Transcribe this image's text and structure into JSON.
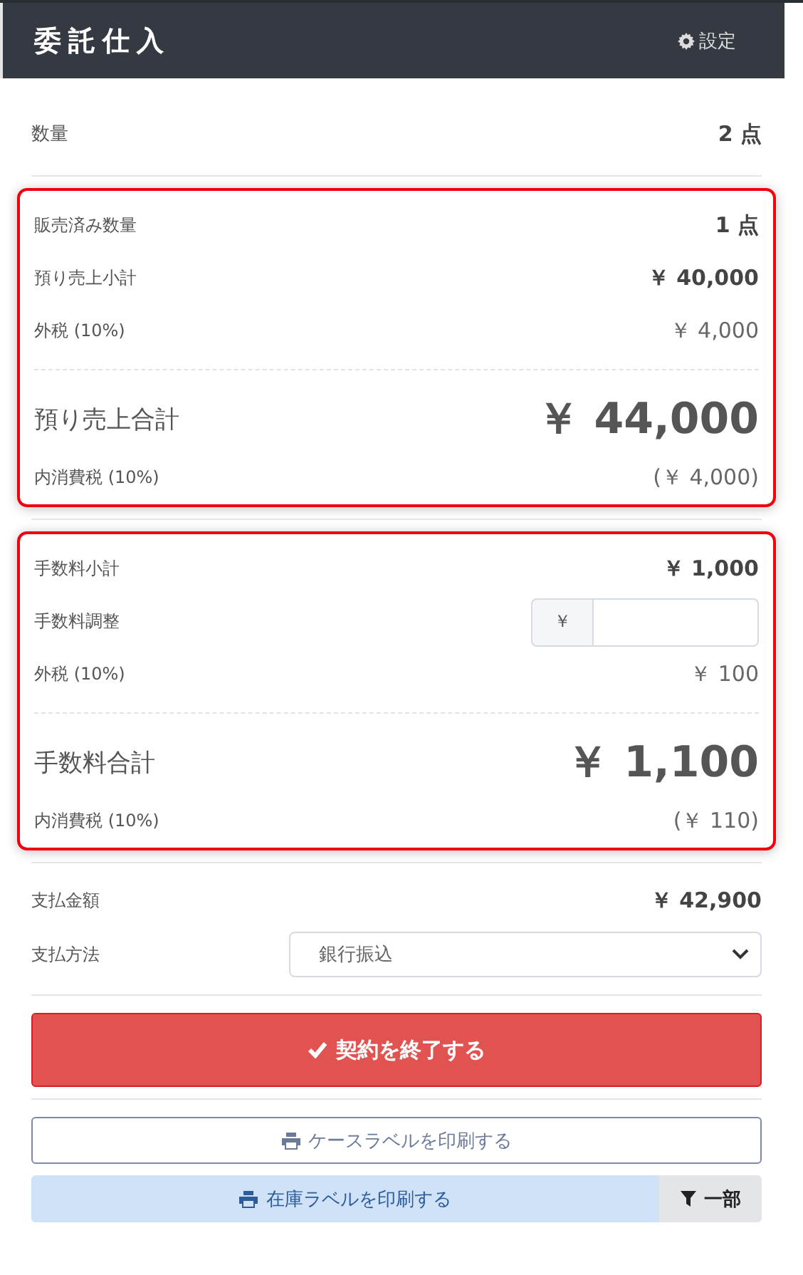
{
  "header": {
    "title": "委託仕入",
    "settings": "設定"
  },
  "quantity": {
    "label": "数量",
    "value": "2 点"
  },
  "sections": [
    {
      "highlighted": true,
      "rows": [
        {
          "kind": "line",
          "label": "販売済み数量",
          "value": "1 点",
          "emphasis": true
        },
        {
          "kind": "line",
          "label": "預り売上小計",
          "value": "￥ 40,000",
          "emphasis": true
        },
        {
          "kind": "line",
          "label": "外税 (10%)",
          "value": "￥ 4,000",
          "emphasis": false
        }
      ],
      "total": {
        "label": "預り売上合計",
        "value": "￥ 44,000"
      },
      "tax": {
        "label": "内消費税 (10%)",
        "value": "(￥ 4,000)"
      }
    },
    {
      "highlighted": true,
      "rows": [
        {
          "kind": "line",
          "label": "手数料小計",
          "value": "￥ 1,000",
          "emphasis": true
        },
        {
          "kind": "input",
          "label": "手数料調整",
          "prefix": "￥"
        },
        {
          "kind": "line",
          "label": "外税 (10%)",
          "value": "￥ 100",
          "emphasis": false
        }
      ],
      "total": {
        "label": "手数料合計",
        "value": "￥ 1,100"
      },
      "tax": {
        "label": "内消費税 (10%)",
        "value": "(￥ 110)"
      }
    }
  ],
  "payment": {
    "amount_label": "支払金額",
    "amount": "￥ 42,900",
    "method_label": "支払方法",
    "method": "銀行振込"
  },
  "finish_button": "契約を終了する",
  "case_label_button": "ケースラベルを印刷する",
  "stock_label_button": "在庫ラベルを印刷する",
  "filter_button": "一部"
}
